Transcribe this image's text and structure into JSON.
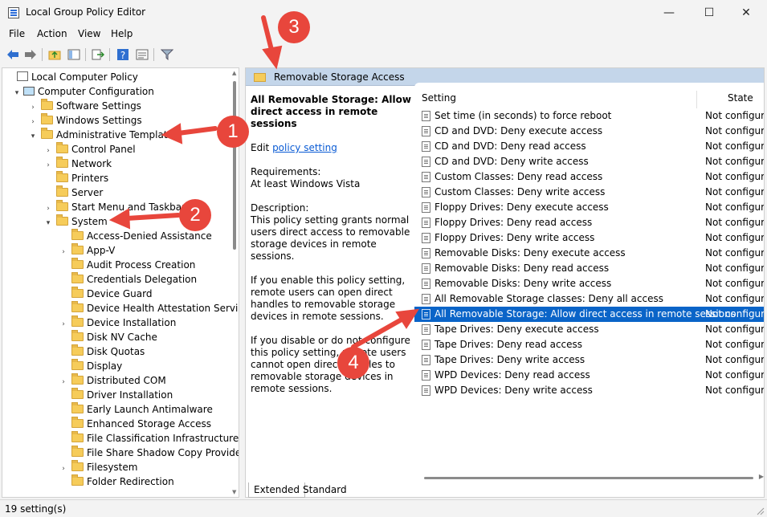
{
  "window": {
    "title": "Local Group Policy Editor",
    "minimize": "—",
    "maximize": "☐",
    "close": "✕"
  },
  "menu": [
    "File",
    "Action",
    "View",
    "Help"
  ],
  "tree": [
    {
      "label": "Local Computer Policy",
      "icon": "doc",
      "indent": 0,
      "exp": ""
    },
    {
      "label": "Computer Configuration",
      "icon": "pc",
      "indent": 1,
      "exp": "▾"
    },
    {
      "label": "Software Settings",
      "icon": "folder",
      "indent": 2,
      "exp": "›"
    },
    {
      "label": "Windows Settings",
      "icon": "folder",
      "indent": 2,
      "exp": "›"
    },
    {
      "label": "Administrative Templates",
      "icon": "folder",
      "indent": 2,
      "exp": "▾"
    },
    {
      "label": "Control Panel",
      "icon": "folder",
      "indent": 3,
      "exp": "›"
    },
    {
      "label": "Network",
      "icon": "folder",
      "indent": 3,
      "exp": "›"
    },
    {
      "label": "Printers",
      "icon": "folder",
      "indent": 3,
      "exp": ""
    },
    {
      "label": "Server",
      "icon": "folder",
      "indent": 3,
      "exp": ""
    },
    {
      "label": "Start Menu and Taskbar",
      "icon": "folder",
      "indent": 3,
      "exp": "›"
    },
    {
      "label": "System",
      "icon": "folder",
      "indent": 3,
      "exp": "▾"
    },
    {
      "label": "Access-Denied Assistance",
      "icon": "folder",
      "indent": 4,
      "exp": ""
    },
    {
      "label": "App-V",
      "icon": "folder",
      "indent": 4,
      "exp": "›"
    },
    {
      "label": "Audit Process Creation",
      "icon": "folder",
      "indent": 4,
      "exp": ""
    },
    {
      "label": "Credentials Delegation",
      "icon": "folder",
      "indent": 4,
      "exp": ""
    },
    {
      "label": "Device Guard",
      "icon": "folder",
      "indent": 4,
      "exp": ""
    },
    {
      "label": "Device Health Attestation Service",
      "icon": "folder",
      "indent": 4,
      "exp": ""
    },
    {
      "label": "Device Installation",
      "icon": "folder",
      "indent": 4,
      "exp": "›"
    },
    {
      "label": "Disk NV Cache",
      "icon": "folder",
      "indent": 4,
      "exp": ""
    },
    {
      "label": "Disk Quotas",
      "icon": "folder",
      "indent": 4,
      "exp": ""
    },
    {
      "label": "Display",
      "icon": "folder",
      "indent": 4,
      "exp": ""
    },
    {
      "label": "Distributed COM",
      "icon": "folder",
      "indent": 4,
      "exp": "›"
    },
    {
      "label": "Driver Installation",
      "icon": "folder",
      "indent": 4,
      "exp": ""
    },
    {
      "label": "Early Launch Antimalware",
      "icon": "folder",
      "indent": 4,
      "exp": ""
    },
    {
      "label": "Enhanced Storage Access",
      "icon": "folder",
      "indent": 4,
      "exp": ""
    },
    {
      "label": "File Classification Infrastructure",
      "icon": "folder",
      "indent": 4,
      "exp": ""
    },
    {
      "label": "File Share Shadow Copy Provider",
      "icon": "folder",
      "indent": 4,
      "exp": ""
    },
    {
      "label": "Filesystem",
      "icon": "folder",
      "indent": 4,
      "exp": "›"
    },
    {
      "label": "Folder Redirection",
      "icon": "folder",
      "indent": 4,
      "exp": ""
    }
  ],
  "right_header": {
    "title": "Removable Storage Access"
  },
  "description": {
    "title": "All Removable Storage: Allow direct access in remote sessions",
    "edit_prefix": "Edit ",
    "edit_link": "policy setting",
    "requirements_label": "Requirements:",
    "requirements_value": "At least Windows Vista",
    "description_label": "Description:",
    "description_body": "This policy setting grants normal users direct access to removable storage devices in remote sessions.",
    "enable_text": "If you enable this policy setting, remote users can open direct handles to removable storage devices in remote sessions.",
    "disable_text": "If you disable or do not configure this policy setting, remote users cannot open direct handles to removable storage devices in remote sessions."
  },
  "columns": {
    "setting": "Setting",
    "state": "State"
  },
  "settings": [
    {
      "name": "Set time (in seconds) to force reboot",
      "state": "Not configured"
    },
    {
      "name": "CD and DVD: Deny execute access",
      "state": "Not configured"
    },
    {
      "name": "CD and DVD: Deny read access",
      "state": "Not configured"
    },
    {
      "name": "CD and DVD: Deny write access",
      "state": "Not configured"
    },
    {
      "name": "Custom Classes: Deny read access",
      "state": "Not configured"
    },
    {
      "name": "Custom Classes: Deny write access",
      "state": "Not configured"
    },
    {
      "name": "Floppy Drives: Deny execute access",
      "state": "Not configured"
    },
    {
      "name": "Floppy Drives: Deny read access",
      "state": "Not configured"
    },
    {
      "name": "Floppy Drives: Deny write access",
      "state": "Not configured"
    },
    {
      "name": "Removable Disks: Deny execute access",
      "state": "Not configured"
    },
    {
      "name": "Removable Disks: Deny read access",
      "state": "Not configured"
    },
    {
      "name": "Removable Disks: Deny write access",
      "state": "Not configured"
    },
    {
      "name": "All Removable Storage classes: Deny all access",
      "state": "Not configured"
    },
    {
      "name": "All Removable Storage: Allow direct access in remote sessions",
      "state": "Not configured",
      "selected": true
    },
    {
      "name": "Tape Drives: Deny execute access",
      "state": "Not configured"
    },
    {
      "name": "Tape Drives: Deny read access",
      "state": "Not configured"
    },
    {
      "name": "Tape Drives: Deny write access",
      "state": "Not configured"
    },
    {
      "name": "WPD Devices: Deny read access",
      "state": "Not configured"
    },
    {
      "name": "WPD Devices: Deny write access",
      "state": "Not configured"
    }
  ],
  "tabs": {
    "extended": "Extended",
    "standard": "Standard"
  },
  "status": "19 setting(s)",
  "annotations": {
    "one": "1",
    "two": "2",
    "three": "3",
    "four": "4",
    "color": "#e8463c"
  }
}
